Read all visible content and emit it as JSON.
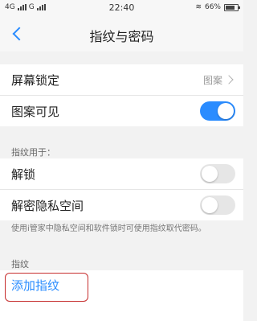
{
  "status_bar": {
    "left": "4G",
    "carrier2": "G",
    "time": "22:40",
    "battery": "66%"
  },
  "header": {
    "title": "指纹与密码"
  },
  "settings": {
    "screen_lock_label": "屏幕锁定",
    "screen_lock_value": "图案",
    "pattern_visible_label": "图案可见",
    "pattern_visible_on": true
  },
  "fingerprint_for": {
    "section_title": "指纹用于：",
    "unlock_label": "解锁",
    "unlock_on": false,
    "private_space_label": "解密隐私空间",
    "private_space_on": false,
    "note": "使用i管家中隐私空间和软件锁时可使用指纹取代密码。"
  },
  "fingerprints": {
    "section_title": "指纹",
    "add_label": "添加指纹"
  }
}
